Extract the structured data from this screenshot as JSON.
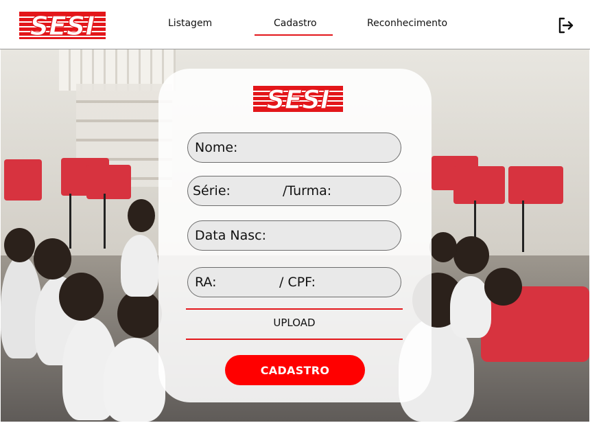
{
  "brand": {
    "logo_text": "SESI",
    "color": "#e3161a"
  },
  "nav": {
    "items": [
      {
        "label": "Listagem",
        "active": false
      },
      {
        "label": "Cadastro",
        "active": true
      },
      {
        "label": "Reconhecimento",
        "active": false
      }
    ],
    "logout_icon": "logout-icon"
  },
  "form": {
    "fields": {
      "nome": "Nome:",
      "serie": "Série:",
      "turma": "/Turma:",
      "data_nasc": "Data Nasc:",
      "ra": "RA:",
      "cpf": "/  CPF:"
    },
    "upload_label": "UPLOAD",
    "submit_label": "CADASTRO"
  },
  "colors": {
    "accent": "#e3161a",
    "button": "#ff0000",
    "field_bg": "#e9e9e9"
  }
}
